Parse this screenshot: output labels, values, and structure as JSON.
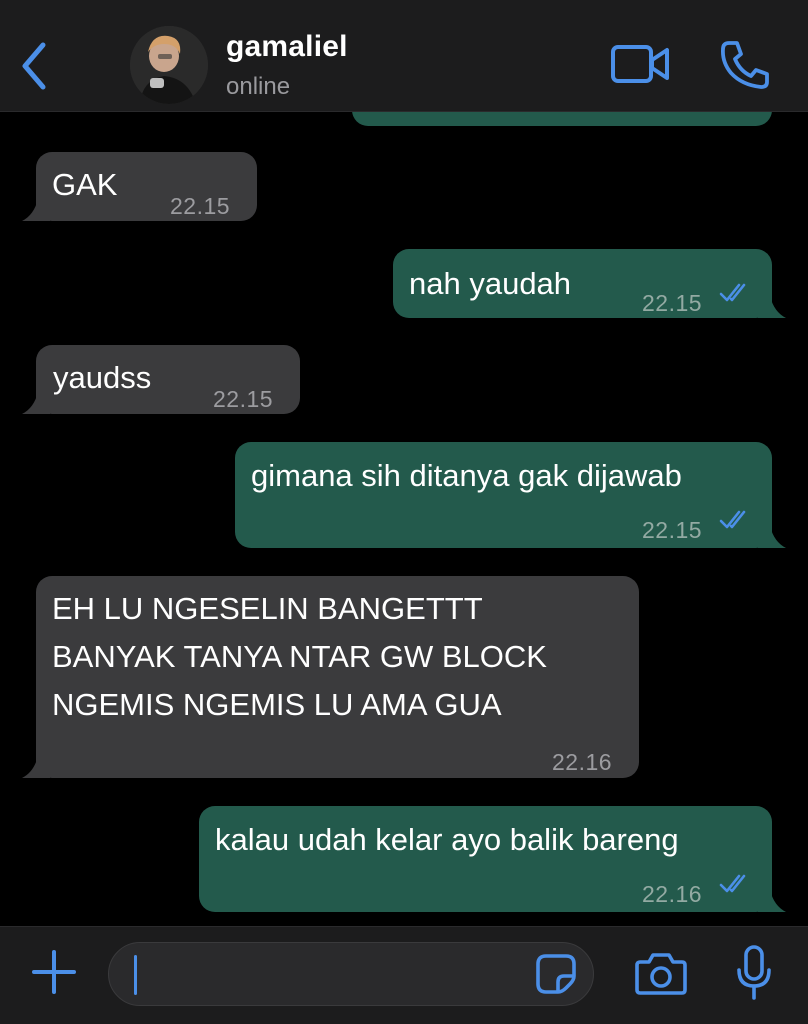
{
  "header": {
    "contact_name": "gamaliel",
    "status": "online",
    "icons": {
      "back": "chevron-left-icon",
      "video": "video-camera-icon",
      "call": "phone-icon"
    }
  },
  "colors": {
    "accent": "#4b8fe8",
    "incoming_bubble": "#3b3b3d",
    "outgoing_bubble": "#235a4c",
    "background": "#000000",
    "header_bg": "#1c1c1d"
  },
  "messages": [
    {
      "direction": "in",
      "text": "GAK",
      "time": "22.15"
    },
    {
      "direction": "out",
      "text": "nah yaudah",
      "time": "22.15",
      "read": true
    },
    {
      "direction": "in",
      "text": "yaudss",
      "time": "22.15"
    },
    {
      "direction": "out",
      "text": "gimana sih ditanya gak dijawab",
      "time": "22.15",
      "read": true
    },
    {
      "direction": "in",
      "text": "EH LU NGESELIN BANGETTT\nBANYAK TANYA NTAR GW BLOCK\nNGEMIS NGEMIS LU AMA GUA",
      "time": "22.16"
    },
    {
      "direction": "out",
      "text": "kalau udah kelar ayo balik bareng",
      "time": "22.16",
      "read": true
    }
  ],
  "composer": {
    "value": "",
    "placeholder": "",
    "icons": {
      "plus": "plus-icon",
      "sticker": "sticker-icon",
      "camera": "camera-icon",
      "mic": "microphone-icon"
    }
  }
}
